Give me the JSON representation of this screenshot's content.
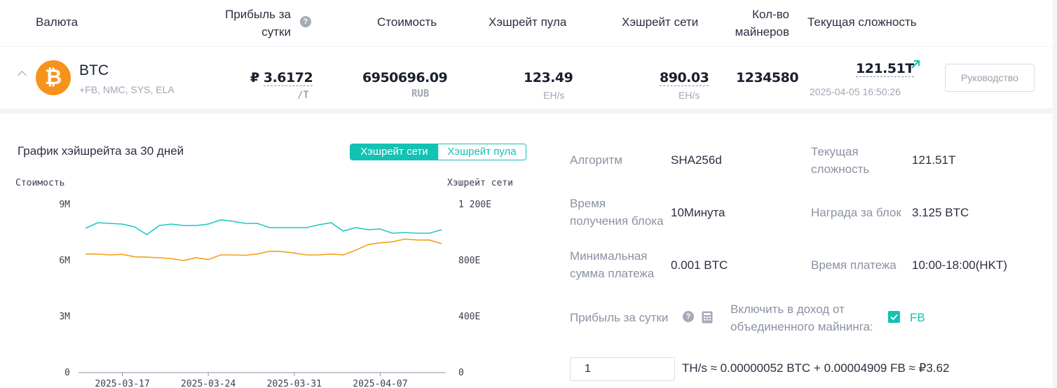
{
  "table_header": {
    "currency": "Валюта",
    "profit_line1": "Прибыль за",
    "profit_line2": "сутки",
    "cost": "Стоимость",
    "pool_hashrate": "Хэшрейт пула",
    "network_hashrate": "Хэшрейт сети",
    "miners_line1": "Кол-во",
    "miners_line2": "майнеров",
    "difficulty": "Текущая сложность"
  },
  "coin_row": {
    "symbol": "BTC",
    "merged": "+FB, NMC, SYS, ELA",
    "profit_currency_sign": "₽",
    "profit_value": "3.6172",
    "profit_unit": "/T",
    "cost_value": "6950696.09",
    "cost_unit": "RUB",
    "pool_hashrate_value": "123.49",
    "pool_hashrate_unit": "EH/s",
    "network_hashrate_value": "890.03",
    "network_hashrate_unit": "EH/s",
    "miners_value": "1234580",
    "difficulty_value": "121.51T",
    "difficulty_time": "2025-04-05 16:50:26",
    "guide_button": "Руководство",
    "colors": {
      "btc": "#f7931a",
      "accent": "#12c2b3"
    }
  },
  "chart_panel": {
    "title": "График хэйшрейта за 30 дней",
    "toggle_network": "Хэшрейт сети",
    "toggle_pool": "Хэшрейт пула",
    "active_toggle": "network",
    "left_axis_label": "Стоимость",
    "right_axis_label": "Хэшрейт сети"
  },
  "chart_data": {
    "type": "line",
    "left_ticks": [
      "9M",
      "6M",
      "3M",
      "0"
    ],
    "right_ticks": [
      "1 200E",
      "800E",
      "400E",
      "0"
    ],
    "x_ticks": [
      "2025-03-17",
      "2025-03-24",
      "2025-03-31",
      "2025-04-07"
    ],
    "x_tick_index": [
      3,
      10,
      17,
      24
    ],
    "ylim_left": [
      0,
      9000000
    ],
    "ylim_right": [
      0,
      1200
    ],
    "colors": {
      "cost": "#f59f1a",
      "network": "#1cc9c0"
    },
    "series": [
      {
        "key": "network",
        "axis": "right",
        "values": [
          1030,
          1070,
          1065,
          1060,
          1040,
          985,
          1050,
          1060,
          1050,
          1050,
          1060,
          1090,
          1080,
          1065,
          1065,
          1035,
          1035,
          1035,
          1035,
          1055,
          1070,
          1010,
          1035,
          1020,
          1025,
          995,
          1000,
          995,
          995,
          1020
        ]
      },
      {
        "key": "cost",
        "axis": "left",
        "values": [
          6350000,
          6350000,
          6300000,
          6330000,
          6200000,
          6180000,
          6150000,
          6100000,
          6000000,
          6150000,
          6050000,
          6300000,
          6300000,
          6280000,
          6350000,
          6500000,
          6480000,
          6400000,
          6300000,
          6300000,
          6350000,
          6300000,
          6550000,
          6850000,
          6950000,
          7000000,
          7150000,
          7100000,
          7100000,
          6900000
        ]
      }
    ]
  },
  "info": {
    "algo_label": "Алгоритм",
    "algo_value": "SHA256d",
    "difficulty_label_1": "Текущая",
    "difficulty_label_2": "сложность",
    "difficulty_value": "121.51T",
    "block_time_label_1": "Время",
    "block_time_label_2": "получения блока",
    "block_time_value": "10Минута",
    "reward_label": "Награда за блок",
    "reward_value": "3.125 BTC",
    "min_payment_label_1": "Минимальная",
    "min_payment_label_2": "сумма платежа",
    "min_payment_value": "0.001 BTC",
    "payment_time_label": "Время платежа",
    "payment_time_value": "10:00-18:00(HKT)",
    "profit_label": "Прибыль за сутки",
    "include_label_1": "Включить в доход от",
    "include_label_2": "объединенного майнинга:",
    "fb_checkbox_label": "FB",
    "fb_checked": true,
    "calc_input_value": "1",
    "calc_result": "TH/s ≈ 0.00000052 BTC + 0.00004909 FB ≈ ₽3.62"
  }
}
